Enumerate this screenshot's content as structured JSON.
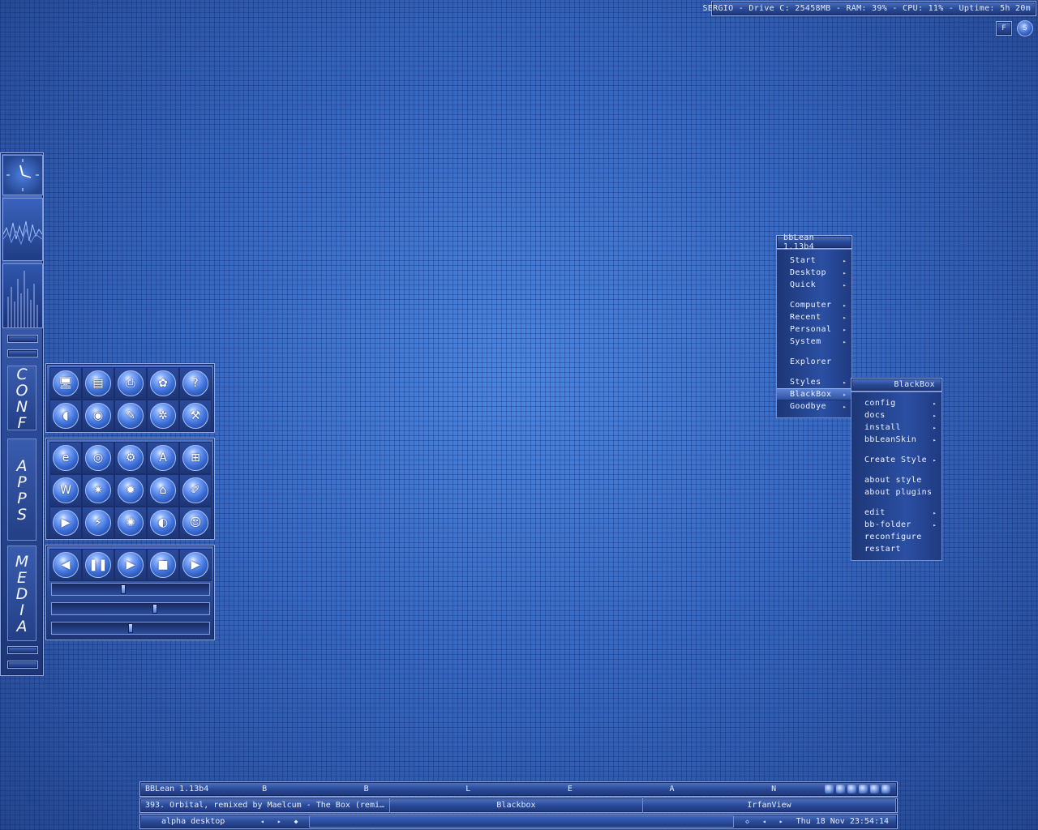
{
  "sysinfo": {
    "text": "SERGIO - Drive C: 25458MB - RAM: 39% - CPU: 11% - Uptime: 5h 20m",
    "btn_f": "F",
    "btn_s": "S"
  },
  "dock": {
    "labels": {
      "conf": "CONF",
      "apps": "APPS",
      "media": "MEDIA"
    }
  },
  "conf_icons": [
    {
      "icon": "my-computer-icon",
      "glyph": "🖥"
    },
    {
      "icon": "file-server-icon",
      "glyph": "▤"
    },
    {
      "icon": "printer-icon",
      "glyph": "⎙"
    },
    {
      "icon": "control-panel-icon",
      "glyph": "✿"
    },
    {
      "icon": "help-icon",
      "glyph": "?"
    },
    {
      "icon": "mouse-icon",
      "glyph": "◖"
    },
    {
      "icon": "speaker-icon",
      "glyph": "◉"
    },
    {
      "icon": "notepad-icon",
      "glyph": "✎"
    },
    {
      "icon": "network-icon",
      "glyph": "✲"
    },
    {
      "icon": "tools-icon",
      "glyph": "⚒"
    }
  ],
  "apps_icons": [
    {
      "icon": "internet-explorer-icon",
      "glyph": "e"
    },
    {
      "icon": "media-disc-icon",
      "glyph": "◎"
    },
    {
      "icon": "settings-icon",
      "glyph": "⚙"
    },
    {
      "icon": "acrobat-icon",
      "glyph": "A"
    },
    {
      "icon": "windows-icon",
      "glyph": "⊞"
    },
    {
      "icon": "word-icon",
      "glyph": "W"
    },
    {
      "icon": "paint-icon",
      "glyph": "✷"
    },
    {
      "icon": "irfanview-icon",
      "glyph": "✹"
    },
    {
      "icon": "home-icon",
      "glyph": "⌂"
    },
    {
      "icon": "pencil-icon",
      "glyph": "✐"
    },
    {
      "icon": "media-player-icon",
      "glyph": "▶"
    },
    {
      "icon": "winamp-icon",
      "glyph": "⚡"
    },
    {
      "icon": "burn-disc-icon",
      "glyph": "✺"
    },
    {
      "icon": "firefox-icon",
      "glyph": "◐"
    },
    {
      "icon": "messenger-icon",
      "glyph": "☺"
    }
  ],
  "media_icons": [
    {
      "icon": "previous-icon",
      "glyph": "◀"
    },
    {
      "icon": "pause-icon",
      "glyph": "❚❚"
    },
    {
      "icon": "play-icon",
      "glyph": "▶"
    },
    {
      "icon": "stop-icon",
      "glyph": "■"
    },
    {
      "icon": "next-icon",
      "glyph": "▶"
    }
  ],
  "media_sliders": [
    {
      "name": "seek-slider",
      "value": 0.45
    },
    {
      "name": "volume-slider",
      "value": 0.66
    },
    {
      "name": "balance-slider",
      "value": 0.5
    }
  ],
  "main_menu": {
    "title": "bbLean 1.13b4",
    "groups": [
      [
        {
          "label": "Start",
          "submenu": true
        },
        {
          "label": "Desktop",
          "submenu": true
        },
        {
          "label": "Quick",
          "submenu": true
        }
      ],
      [
        {
          "label": "Computer",
          "submenu": true
        },
        {
          "label": "Recent",
          "submenu": true
        },
        {
          "label": "Personal",
          "submenu": true
        },
        {
          "label": "System",
          "submenu": true
        }
      ],
      [
        {
          "label": "Explorer",
          "submenu": false
        }
      ],
      [
        {
          "label": "Styles",
          "submenu": true
        },
        {
          "label": "BlackBox",
          "submenu": true,
          "active": true
        },
        {
          "label": "Goodbye",
          "submenu": true
        }
      ]
    ]
  },
  "bb_menu": {
    "title": "BlackBox",
    "groups": [
      [
        {
          "label": "config",
          "submenu": true
        },
        {
          "label": "docs",
          "submenu": true
        },
        {
          "label": "install",
          "submenu": true
        },
        {
          "label": "bbLeanSkin",
          "submenu": true
        }
      ],
      [
        {
          "label": "Create Style",
          "submenu": true
        }
      ],
      [
        {
          "label": "about style",
          "submenu": false
        },
        {
          "label": "about plugins",
          "submenu": false
        }
      ],
      [
        {
          "label": "edit",
          "submenu": true
        },
        {
          "label": "bb-folder",
          "submenu": true
        },
        {
          "label": "reconfigure",
          "submenu": false
        },
        {
          "label": "restart",
          "submenu": false
        }
      ]
    ]
  },
  "toolbar": {
    "app_label": "BBLean 1.13b4",
    "workspace_letters": [
      "B",
      "B",
      "L",
      "E",
      "A",
      "N"
    ],
    "tray_icons": [
      "tray-icon-1",
      "tray-icon-2",
      "tray-icon-3",
      "tray-icon-4",
      "tray-icon-5",
      "tray-icon-6"
    ],
    "tasks": [
      {
        "label": "393. Orbital, remixed by Maelcum - The Box (remi…",
        "width": 308
      },
      {
        "label": "Blackbox",
        "width": 312
      },
      {
        "label": "IrfanView",
        "width": 312
      }
    ],
    "workspace_name": "alpha desktop",
    "prev_ws": "◂",
    "next_ws": "▸",
    "ws_dot": "◆",
    "prev_task": "◂",
    "next_task": "▸",
    "task_dot": "◇",
    "clock": "Thu 18 Nov 23:54:14"
  }
}
